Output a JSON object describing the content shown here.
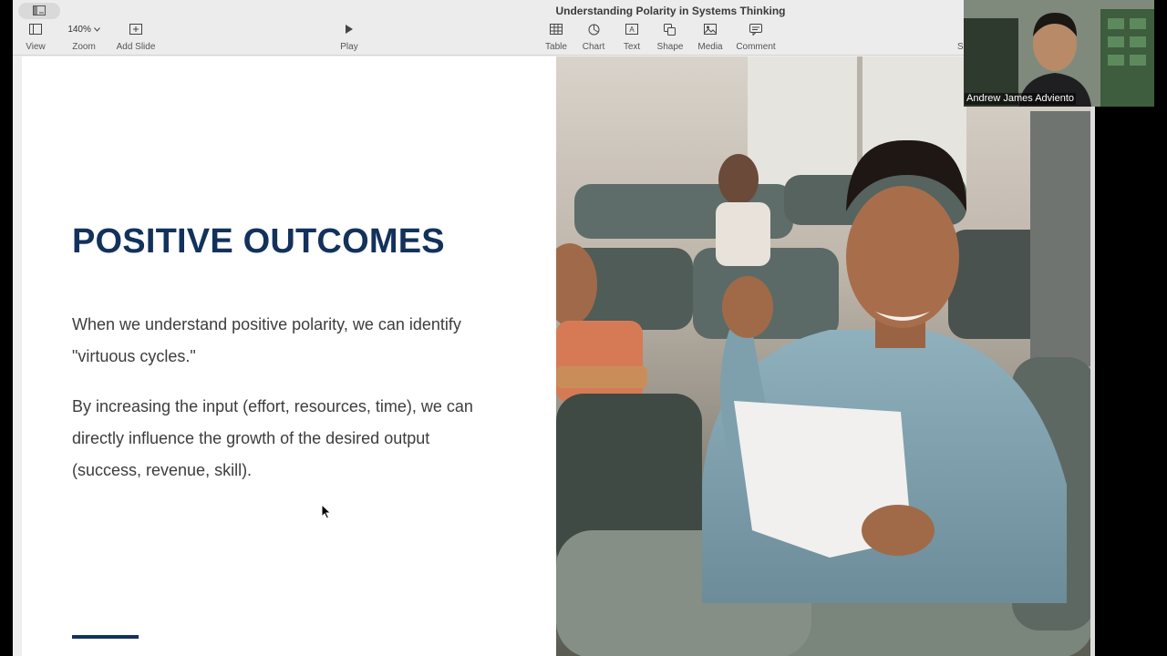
{
  "window": {
    "title": "Understanding Polarity in Systems Thinking"
  },
  "toolbar": {
    "view_label": "View",
    "zoom_value": "140%",
    "zoom_label": "Zoom",
    "add_slide_label": "Add Slide",
    "play_label": "Play",
    "table_label": "Table",
    "chart_label": "Chart",
    "text_label": "Text",
    "shape_label": "Shape",
    "media_label": "Media",
    "comment_label": "Comment",
    "truncated_label": "S"
  },
  "slide": {
    "title": "POSITIVE OUTCOMES",
    "paragraph_1": "When we understand positive polarity, we can identify \"virtuous cycles.\"",
    "paragraph_2": "By increasing the input (effort, resources, time), we can directly influence the growth of the desired output (success, revenue, skill).",
    "title_color": "#12325c"
  },
  "webcam": {
    "participant_name": "Andrew James Adviento"
  },
  "icons": [
    "sidebar-icon",
    "view-icon",
    "chevron-down-icon",
    "add-slide-icon",
    "play-icon",
    "table-icon",
    "chart-icon",
    "text-icon",
    "shape-icon",
    "media-icon",
    "comment-icon",
    "cursor-icon"
  ]
}
